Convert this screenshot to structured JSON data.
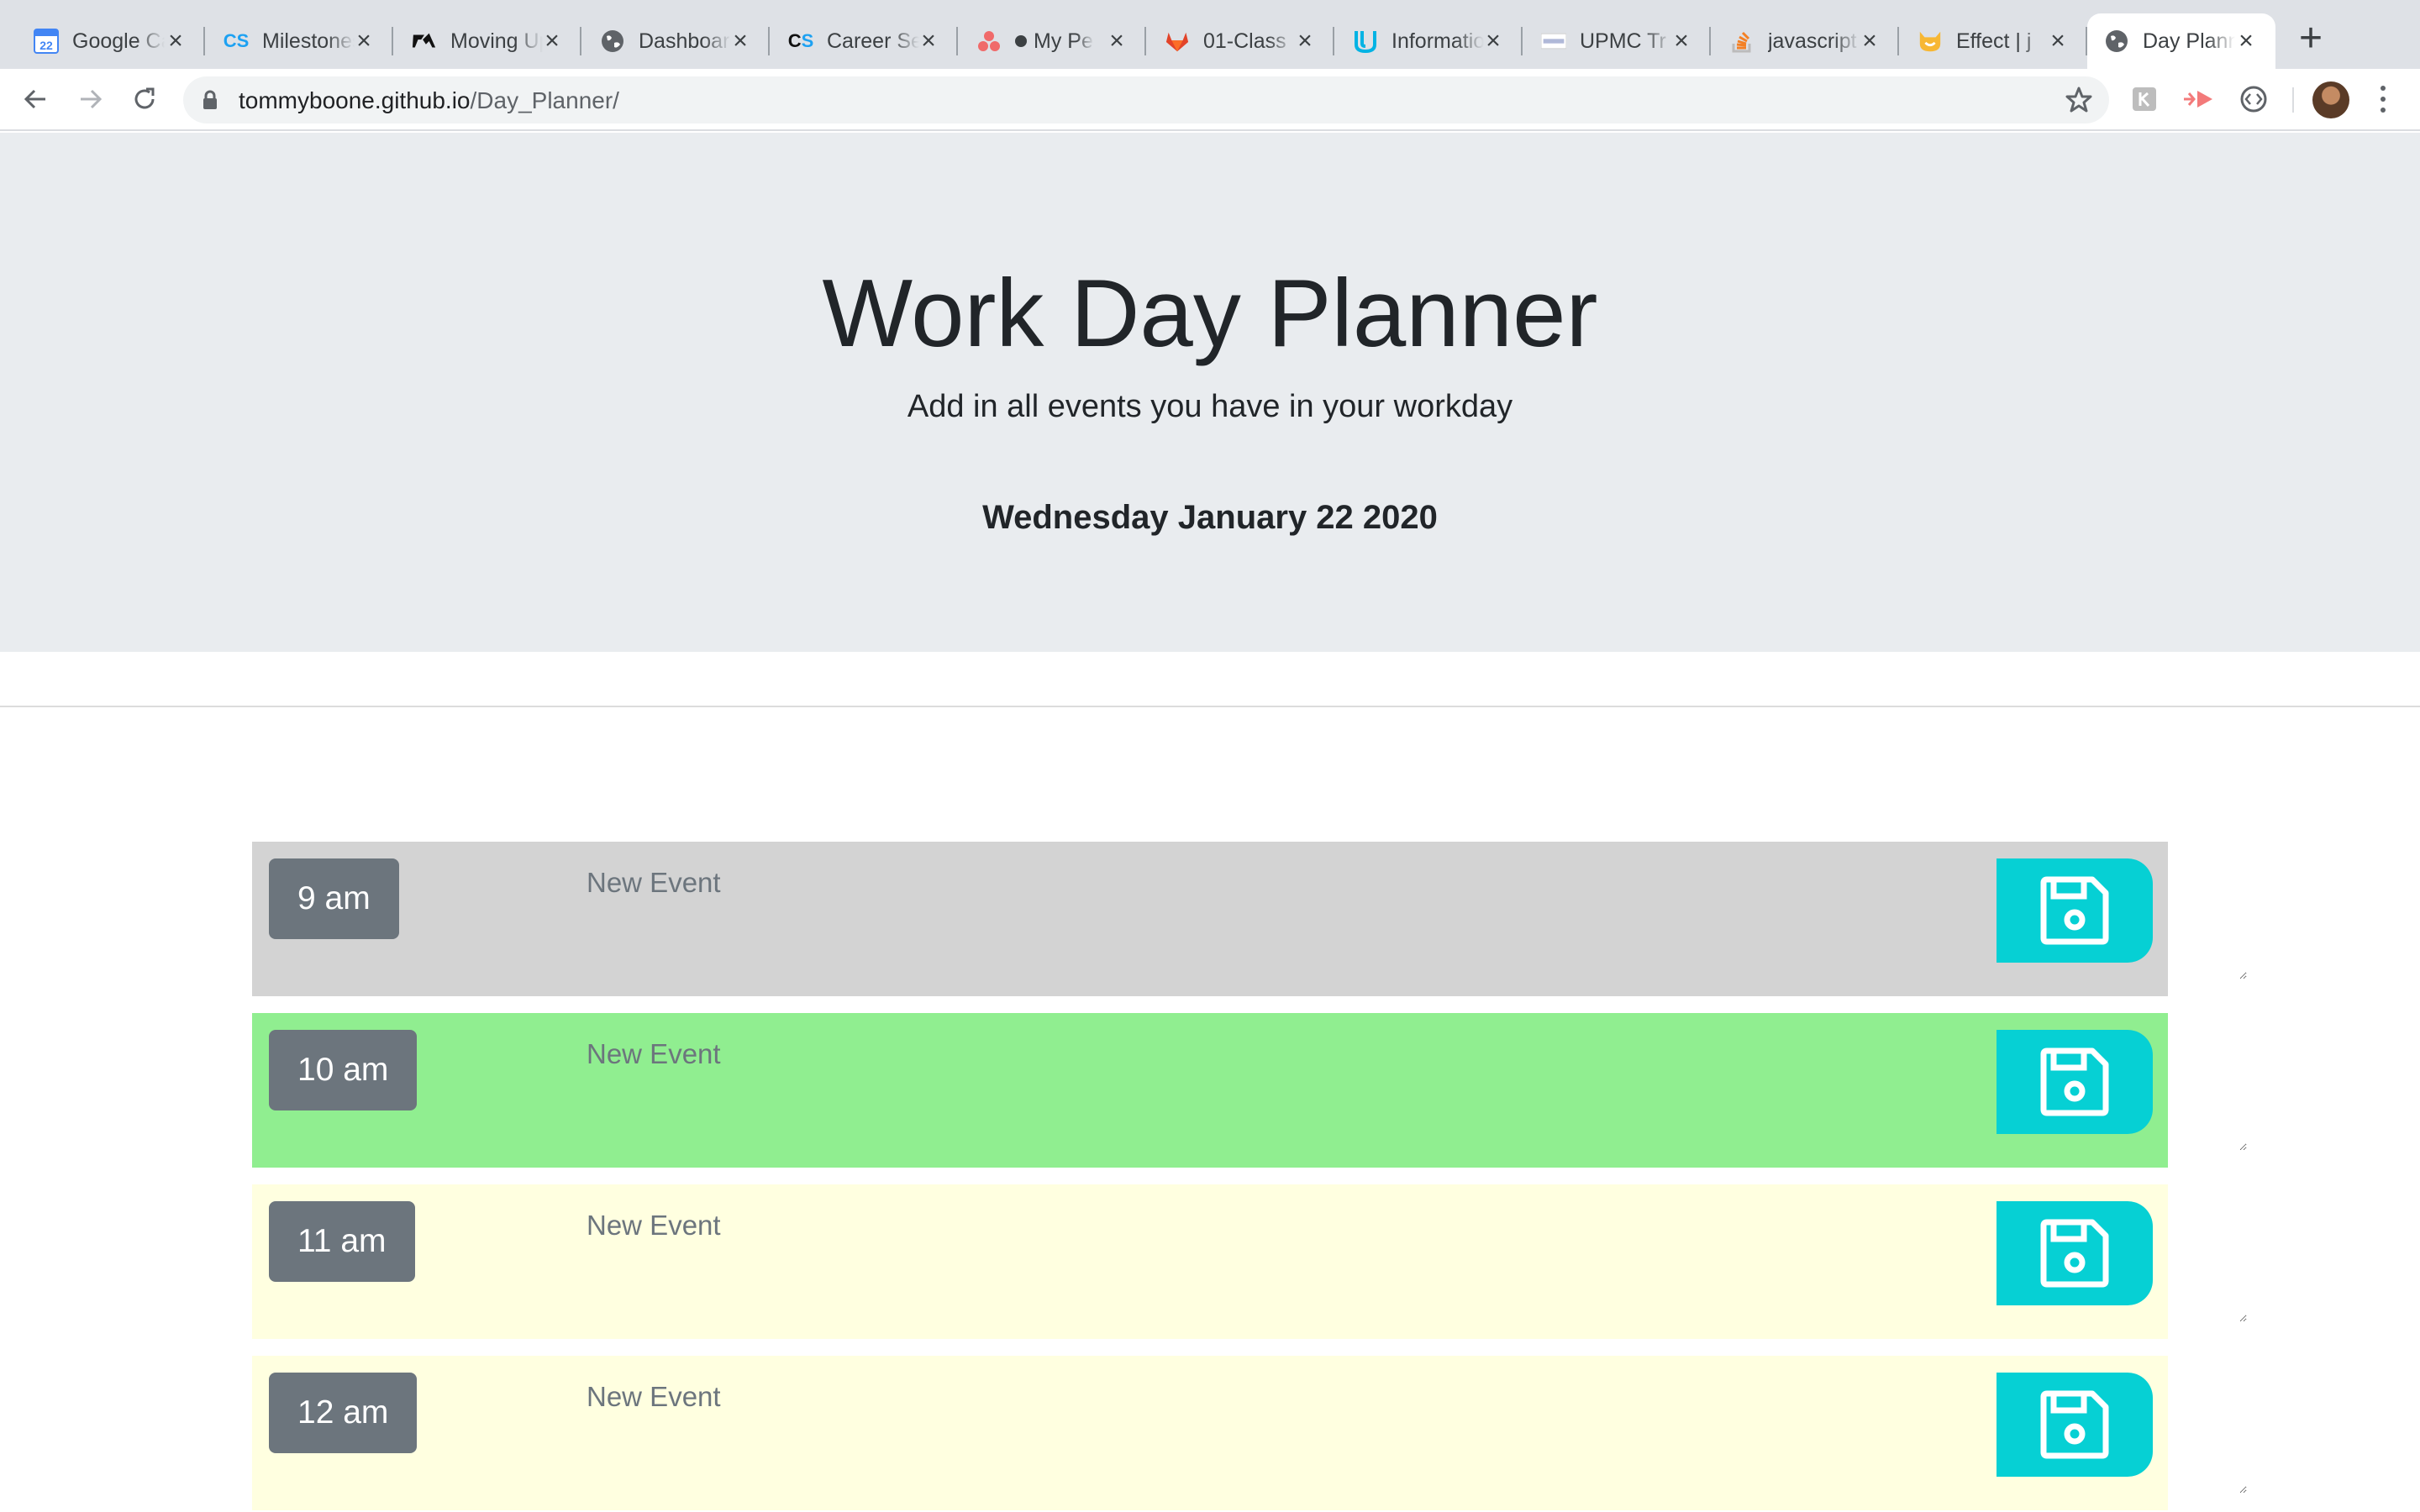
{
  "browser": {
    "tabs": [
      {
        "title": "Google Calendar",
        "icon": "google-calendar-icon"
      },
      {
        "title": "Milestones",
        "icon": "codesignal-icon"
      },
      {
        "title": "Moving Up",
        "icon": "ta-icon"
      },
      {
        "title": "Dashboard",
        "icon": "globe-icon"
      },
      {
        "title": "Career Services",
        "icon": "codesignal-icon"
      },
      {
        "title": "My Personal",
        "icon": "asana-icon"
      },
      {
        "title": "01-Class",
        "icon": "gitlab-icon"
      },
      {
        "title": "Information",
        "icon": "udacity-icon"
      },
      {
        "title": "UPMC Tr",
        "icon": "upmc-icon"
      },
      {
        "title": "javascript",
        "icon": "stackoverflow-icon"
      },
      {
        "title": "Effect | j",
        "icon": "codepen-cat-icon"
      },
      {
        "title": "Day Planner",
        "icon": "globe-icon",
        "active": true
      }
    ],
    "calendar_day": "22",
    "url_host": "tommyboone.github.io",
    "url_path": "/Day_Planner/"
  },
  "header": {
    "title": "Work Day Planner",
    "lead": "Add in all events you have in your workday",
    "current_day": "Wednesday January 22 2020"
  },
  "time_blocks": [
    {
      "hour": "9 am",
      "placeholder": "New Event",
      "status": "past"
    },
    {
      "hour": "10 am",
      "placeholder": "New Event",
      "status": "present"
    },
    {
      "hour": "11 am",
      "placeholder": "New Event",
      "status": "future"
    },
    {
      "hour": "12 am",
      "placeholder": "New Event",
      "status": "future"
    }
  ],
  "colors": {
    "past": "#d3d3d3",
    "present": "#90ee90",
    "future": "#ffffe0",
    "save_button": "#06d0d4",
    "hour_badge": "#6c757d",
    "jumbotron": "#e9ecef"
  }
}
